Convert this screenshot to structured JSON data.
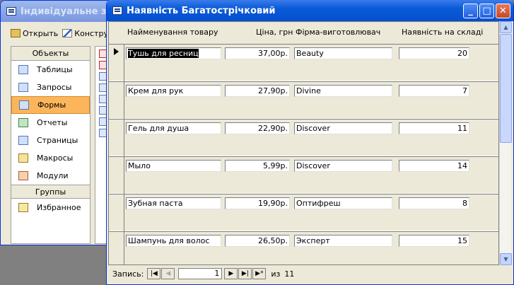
{
  "db_window": {
    "title": "Індивідуальне зав",
    "toolbar": {
      "open_label": "Открыть",
      "design_label": "Конструк"
    },
    "objects_header": "Объекты",
    "objects": [
      {
        "label": "Таблицы",
        "icon": "table-icon"
      },
      {
        "label": "Запросы",
        "icon": "query-icon"
      },
      {
        "label": "Формы",
        "icon": "form-icon",
        "active": true
      },
      {
        "label": "Отчеты",
        "icon": "report-icon"
      },
      {
        "label": "Страницы",
        "icon": "page-icon"
      },
      {
        "label": "Макросы",
        "icon": "macro-icon"
      },
      {
        "label": "Модули",
        "icon": "module-icon"
      }
    ],
    "groups_header": "Группы",
    "groups": [
      {
        "label": "Избранное",
        "icon": "favorites-icon"
      }
    ]
  },
  "form_window": {
    "title": "Наявність Багатострічковий",
    "controls": {
      "minimize": "_",
      "maximize": "□",
      "close": "✕"
    },
    "headers": {
      "product": "Найменування товару",
      "price": "Ціна, грн",
      "manufacturer": "Фірма-виготовлювач",
      "stock": "Наявність на складі"
    },
    "records": [
      {
        "product": "Тушь для ресниц",
        "price": "37,00р.",
        "manufacturer": "Beauty",
        "stock": "20"
      },
      {
        "product": "Крем для рук",
        "price": "27,90р.",
        "manufacturer": "Divine",
        "stock": "7"
      },
      {
        "product": "Гель для душа",
        "price": "22,90р.",
        "manufacturer": "Discover",
        "stock": "11"
      },
      {
        "product": "Мыло",
        "price": "5,99р.",
        "manufacturer": "Discover",
        "stock": "14"
      },
      {
        "product": "Зубная паста",
        "price": "19,90р.",
        "manufacturer": "Оптифреш",
        "stock": "8"
      },
      {
        "product": "Шампунь для волос",
        "price": "26,50р.",
        "manufacturer": "Эксперт",
        "stock": "15"
      }
    ],
    "navigation": {
      "record_label": "Запись:",
      "current_record": "1",
      "of_label": "из",
      "total_records": "11"
    }
  }
}
